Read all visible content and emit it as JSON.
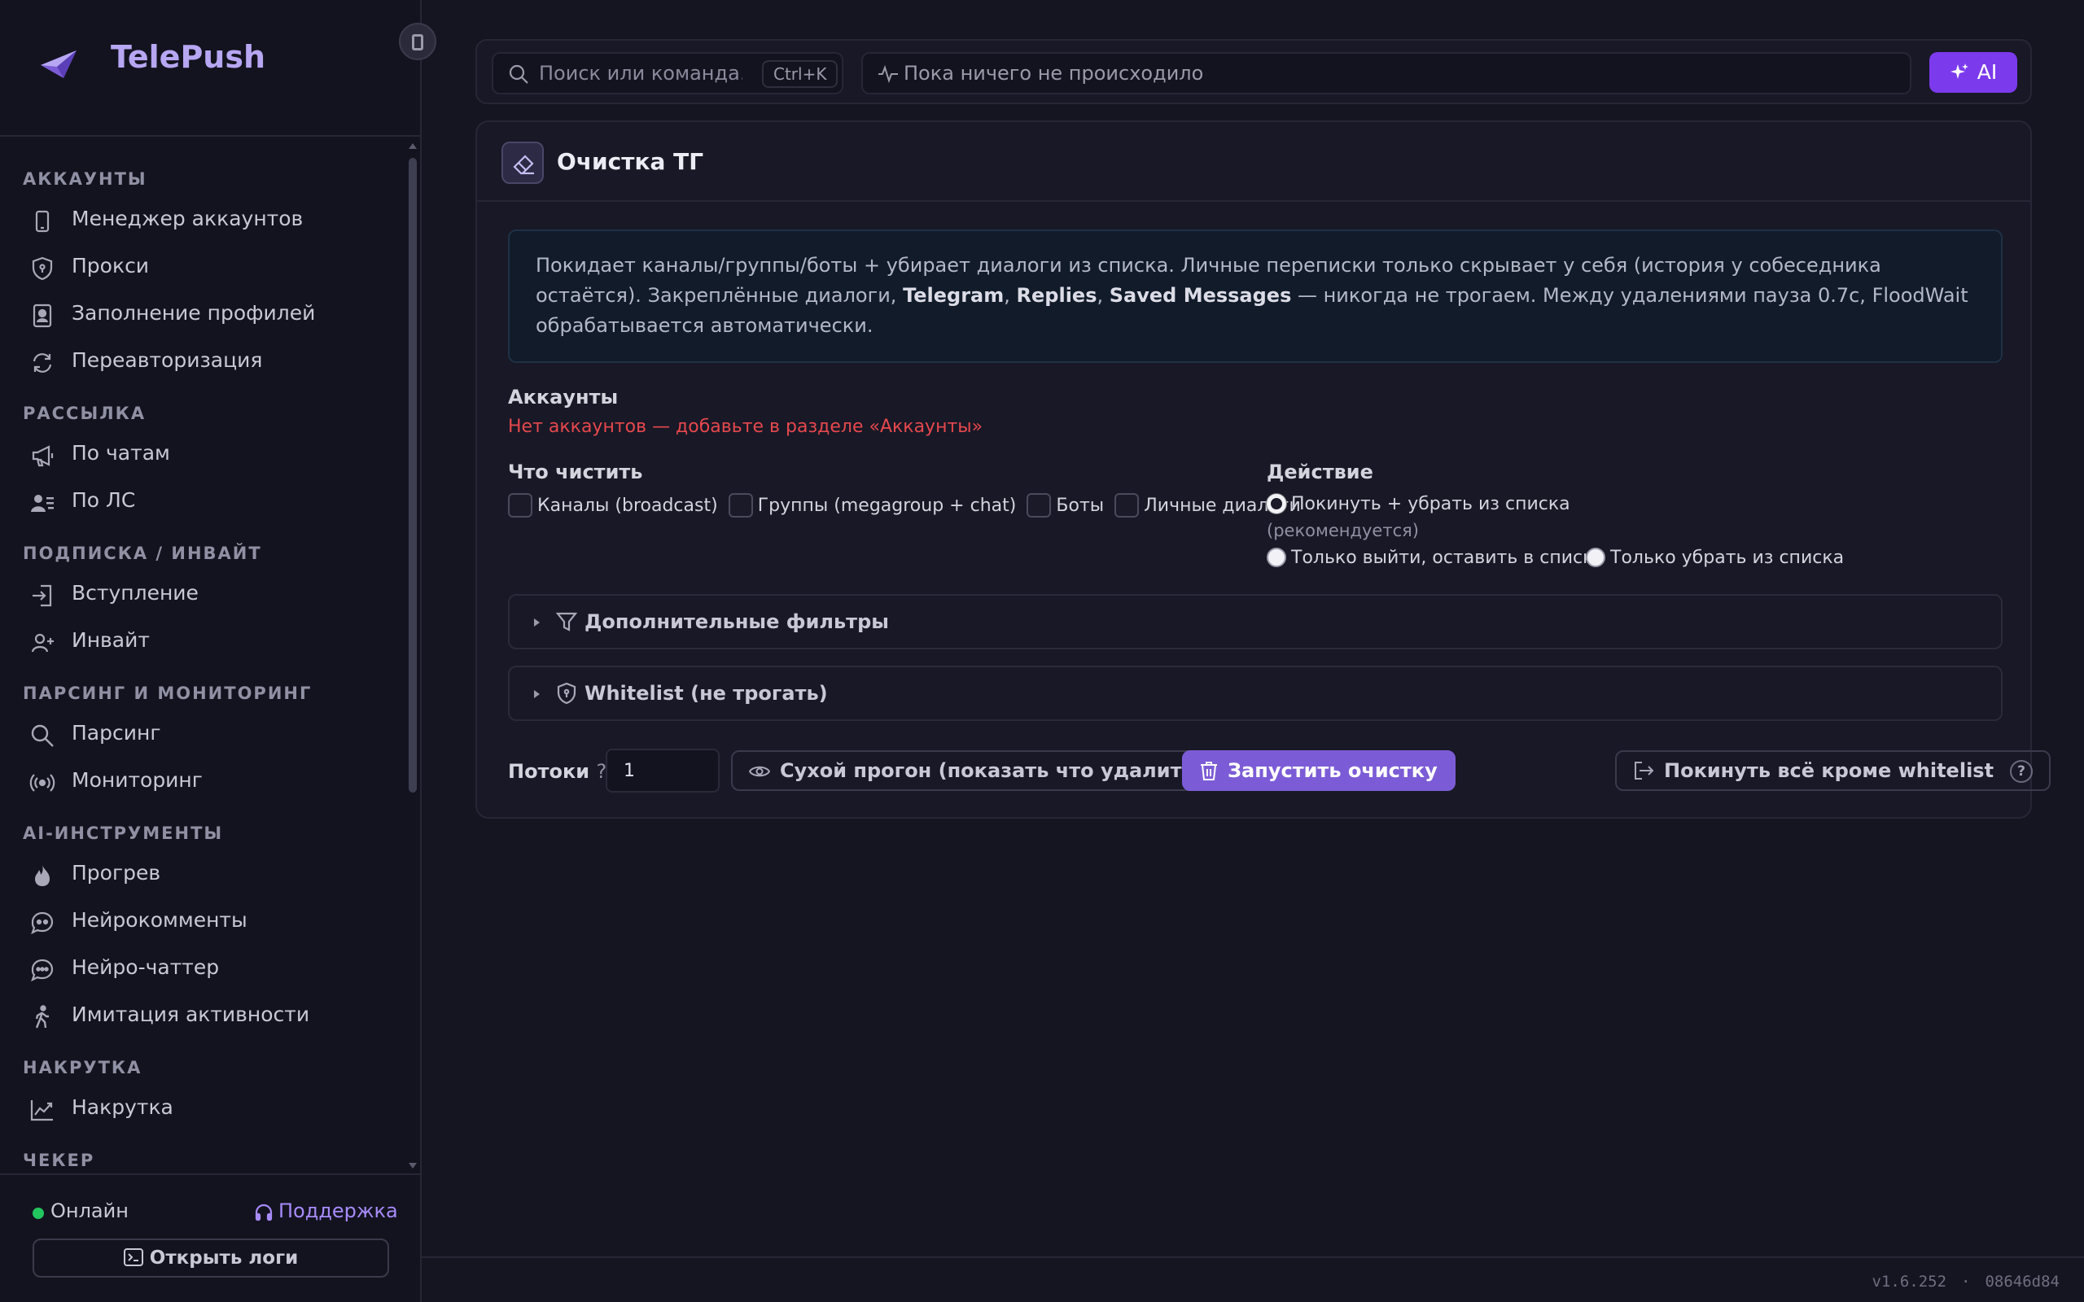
{
  "app": {
    "name": "TelePush",
    "version": "v1.6.252",
    "build": "08646d84"
  },
  "sidebar": {
    "sections": [
      {
        "title": "АККАУНТЫ",
        "items": [
          {
            "label": "Менеджер аккаунтов",
            "icon": "phone-icon"
          },
          {
            "label": "Прокси",
            "icon": "shield-icon"
          },
          {
            "label": "Заполнение профилей",
            "icon": "id-card-icon"
          },
          {
            "label": "Переавторизация",
            "icon": "refresh-icon"
          }
        ]
      },
      {
        "title": "РАССЫЛКА",
        "items": [
          {
            "label": "По чатам",
            "icon": "megaphone-icon"
          },
          {
            "label": "По ЛС",
            "icon": "user-list-icon"
          }
        ]
      },
      {
        "title": "ПОДПИСКА / ИНВАЙТ",
        "items": [
          {
            "label": "Вступление",
            "icon": "login-icon"
          },
          {
            "label": "Инвайт",
            "icon": "user-plus-icon"
          }
        ]
      },
      {
        "title": "ПАРСИНГ И МОНИТОРИНГ",
        "items": [
          {
            "label": "Парсинг",
            "icon": "search-icon"
          },
          {
            "label": "Мониторинг",
            "icon": "broadcast-icon"
          }
        ]
      },
      {
        "title": "AI-ИНСТРУМЕНТЫ",
        "items": [
          {
            "label": "Прогрев",
            "icon": "flame-icon"
          },
          {
            "label": "Нейрокомменты",
            "icon": "quote-bubble-icon"
          },
          {
            "label": "Нейро-чаттер",
            "icon": "chat-dots-icon"
          },
          {
            "label": "Имитация активности",
            "icon": "walking-icon"
          }
        ]
      },
      {
        "title": "НАКРУТКА",
        "items": [
          {
            "label": "Накрутка",
            "icon": "trend-up-icon"
          }
        ]
      },
      {
        "title": "ЧЕКЕР",
        "items": []
      }
    ],
    "footer": {
      "status": "Онлайн",
      "status_color": "#22c55e",
      "support": "Поддержка",
      "logs_button": "Открыть логи"
    }
  },
  "topbar": {
    "search_placeholder": "Поиск или команда…",
    "search_shortcut": "Ctrl+K",
    "activity": "Пока ничего не происходило",
    "ai_button": "AI"
  },
  "card": {
    "title": "Очистка ТГ",
    "info_parts": [
      {
        "text": "Покидает каналы/группы/боты + убирает диалоги из списка. Личные переписки только скрывает у себя (история у собеседника остаётся). Закреплённые диалоги, ",
        "bold": false
      },
      {
        "text": "Telegram",
        "bold": true
      },
      {
        "text": ", ",
        "bold": false
      },
      {
        "text": "Replies",
        "bold": true
      },
      {
        "text": ", ",
        "bold": false
      },
      {
        "text": "Saved Messages",
        "bold": true
      },
      {
        "text": " — никогда не трогаем. Между удалениями пауза 0.7с, FloodWait обрабатывается автоматически.",
        "bold": false
      }
    ],
    "accounts_label": "Аккаунты",
    "accounts_warning": "Нет аккаунтов — добавьте в разделе «Аккаунты»",
    "what_to_clean_label": "Что чистить",
    "clean_options": [
      {
        "label": "Каналы (broadcast)",
        "checked": false
      },
      {
        "label": "Группы (megagroup + chat)",
        "checked": false
      },
      {
        "label": "Боты",
        "checked": false
      },
      {
        "label": "Личные диалоги",
        "checked": false
      }
    ],
    "action_label": "Действие",
    "action_options": [
      {
        "label": "Покинуть + убрать из списка",
        "note": "(рекомендуется)",
        "checked": true
      },
      {
        "label": "Только выйти, оставить в списке",
        "checked": false
      },
      {
        "label": "Только убрать из списка",
        "checked": false
      }
    ],
    "filters_label": "Дополнительные фильтры",
    "whitelist_label": "Whitelist (не трогать)",
    "threads_label": "Потоки",
    "threads_help": "?",
    "threads_value": "1",
    "dry_run_button": "Сухой прогон (показать что удалится)",
    "run_button": "Запустить очистку",
    "leave_all_button": "Покинуть всё кроме whitelist",
    "leave_all_help": "?"
  },
  "colors": {
    "accent": "#7c3aed",
    "accent_soft": "#7c5cd6",
    "warning": "#e5484d",
    "brand_text": "#b7a6f2"
  }
}
